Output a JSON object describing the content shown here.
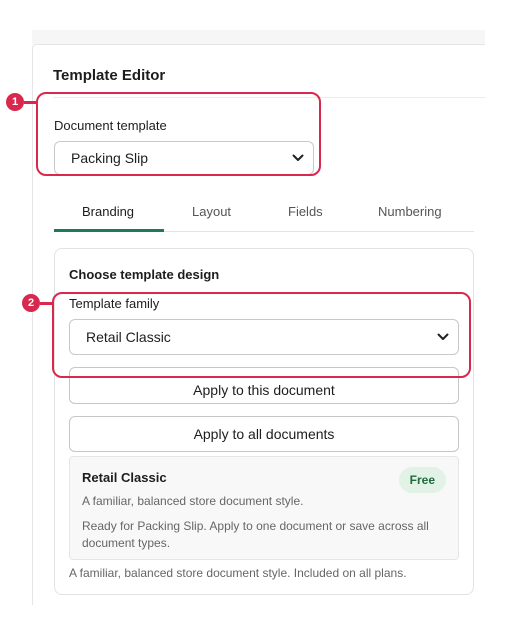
{
  "panel": {
    "title": "Template Editor"
  },
  "document_template": {
    "label": "Document template",
    "selected": "Packing Slip"
  },
  "tabs": [
    {
      "label": "Branding",
      "active": true
    },
    {
      "label": "Layout",
      "active": false
    },
    {
      "label": "Fields",
      "active": false
    },
    {
      "label": "Numbering",
      "active": false
    }
  ],
  "design": {
    "heading": "Choose template design",
    "family_label": "Template family",
    "family_selected": "Retail Classic",
    "apply_this_label": "Apply to this document",
    "apply_all_label": "Apply to all documents",
    "info": {
      "title": "Retail Classic",
      "badge": "Free",
      "description": "A familiar, balanced store document style.",
      "note": "Ready for Packing Slip. Apply to one document or save across all document types."
    },
    "footer": "A familiar, balanced store document style. Included on all plans."
  },
  "callouts": [
    {
      "number": "1"
    },
    {
      "number": "2"
    }
  ],
  "colors": {
    "accent": "#1c7a5a",
    "callout": "#d8284e",
    "badge_bg": "#e3f2e6",
    "badge_text": "#1f6b3b"
  }
}
